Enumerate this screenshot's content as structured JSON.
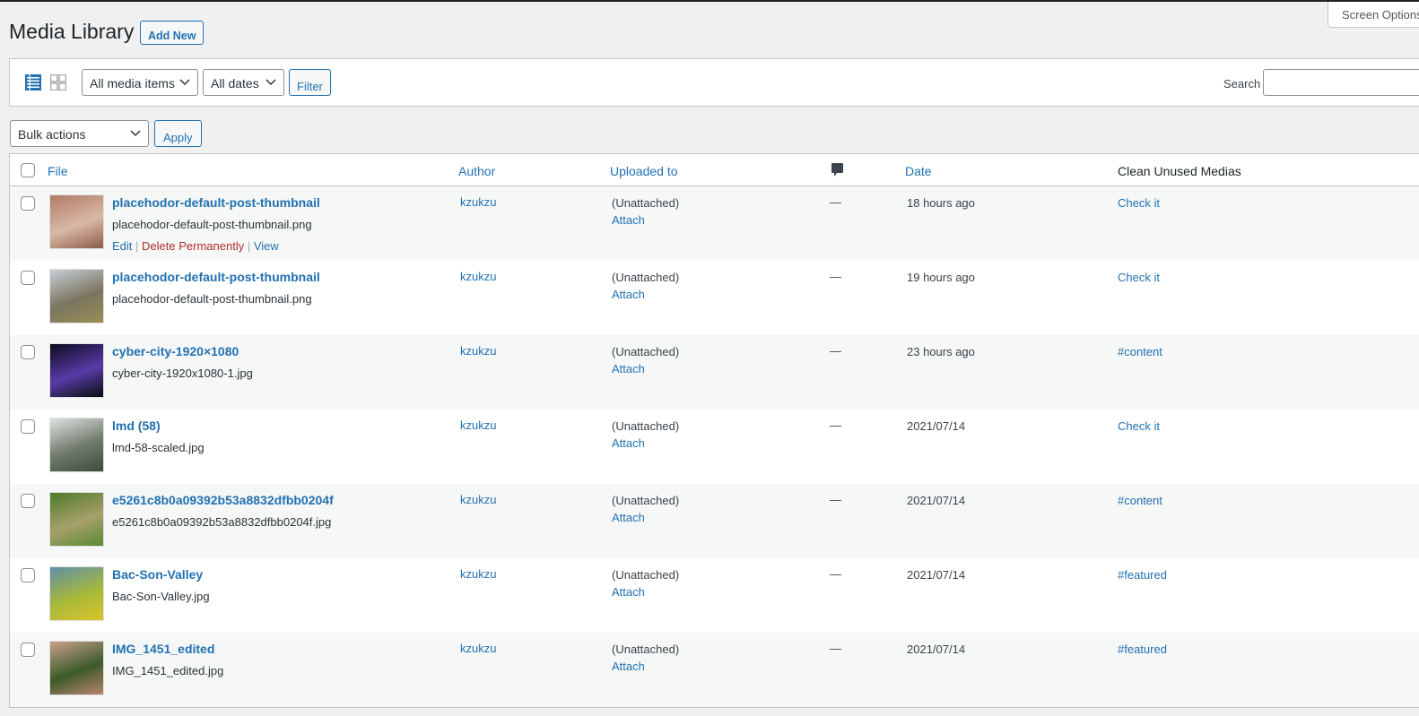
{
  "header": {
    "title": "Media Library",
    "add_new_label": "Add New",
    "screen_options_label": "Screen Options"
  },
  "filters": {
    "view_list_icon": "list-view-icon",
    "view_grid_icon": "grid-view-icon",
    "media_type_selected": "All media items",
    "date_selected": "All dates",
    "filter_label": "Filter",
    "search_label": "Search",
    "search_value": ""
  },
  "bulk": {
    "selected": "Bulk actions",
    "apply_label": "Apply"
  },
  "table": {
    "columns": {
      "file": "File",
      "author": "Author",
      "uploaded_to": "Uploaded to",
      "comments_icon": "comment-bubble-icon",
      "date": "Date",
      "clean_unused": "Clean Unused Medias"
    },
    "rows": [
      {
        "title": "placehodor-default-post-thumbnail",
        "filename": "placehodor-default-post-thumbnail.png",
        "author": "kzukzu",
        "uploaded_to": "(Unattached)",
        "attach": "Attach",
        "comments": "—",
        "date": "18 hours ago",
        "clean": "Check it",
        "thumb": [
          "#b07a68",
          "#d9b9a6",
          "#8c5b4a"
        ]
      },
      {
        "title": "placehodor-default-post-thumbnail",
        "filename": "placehodor-default-post-thumbnail.png",
        "author": "kzukzu",
        "uploaded_to": "(Unattached)",
        "attach": "Attach",
        "comments": "—",
        "date": "19 hours ago",
        "clean": "Check it",
        "thumb": [
          "#c7ced6",
          "#7a7560",
          "#9a8e55"
        ]
      },
      {
        "title": "cyber-city-1920×1080",
        "filename": "cyber-city-1920x1080-1.jpg",
        "author": "kzukzu",
        "uploaded_to": "(Unattached)",
        "attach": "Attach",
        "comments": "—",
        "date": "23 hours ago",
        "clean": "#content",
        "thumb": [
          "#0b0b1e",
          "#5a3aa8",
          "#06100a"
        ]
      },
      {
        "title": "lmd (58)",
        "filename": "lmd-58-scaled.jpg",
        "author": "kzukzu",
        "uploaded_to": "(Unattached)",
        "attach": "Attach",
        "comments": "—",
        "date": "2021/07/14",
        "clean": "Check it",
        "thumb": [
          "#dfe2e2",
          "#6f7a6a",
          "#3d4a3e"
        ]
      },
      {
        "title": "e5261c8b0a09392b53a8832dfbb0204f",
        "filename": "e5261c8b0a09392b53a8832dfbb0204f.jpg",
        "author": "kzukzu",
        "uploaded_to": "(Unattached)",
        "attach": "Attach",
        "comments": "—",
        "date": "2021/07/14",
        "clean": "#content",
        "thumb": [
          "#4e7a2a",
          "#a7a06b",
          "#5a8a30"
        ]
      },
      {
        "title": "Bac-Son-Valley",
        "filename": "Bac-Son-Valley.jpg",
        "author": "kzukzu",
        "uploaded_to": "(Unattached)",
        "attach": "Attach",
        "comments": "—",
        "date": "2021/07/14",
        "clean": "#featured",
        "thumb": [
          "#5f8fa8",
          "#a8b93a",
          "#d8c42a"
        ]
      },
      {
        "title": "IMG_1451_edited",
        "filename": "IMG_1451_edited.jpg",
        "author": "kzukzu",
        "uploaded_to": "(Unattached)",
        "attach": "Attach",
        "comments": "—",
        "date": "2021/07/14",
        "clean": "#featured",
        "thumb": [
          "#c9a18a",
          "#3c5a2a",
          "#b8846e"
        ]
      }
    ],
    "row_actions": {
      "edit": "Edit",
      "delete": "Delete Permanently",
      "view": "View",
      "sep": "|"
    }
  }
}
